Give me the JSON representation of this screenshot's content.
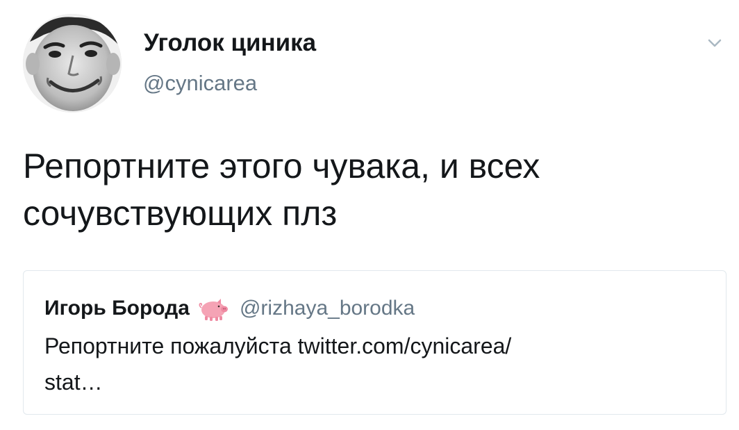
{
  "tweet": {
    "display_name": "Уголок циника",
    "handle": "@cynicarea",
    "text_line1": "Репортните этого чувака, и всех",
    "text_line2": "сочувствующих плз"
  },
  "quoted_tweet": {
    "display_name": "Игорь Борода",
    "badge_icon": "pig-emoji-icon",
    "handle": "@rizhaya_borodka",
    "text_line1": "Репортните пожалуйста twitter.com/cynicarea/",
    "text_line2": "stat…"
  },
  "colors": {
    "text_primary": "#14171a",
    "text_secondary": "#657786",
    "border": "#e1e8ed",
    "caret": "#aab8c2"
  }
}
